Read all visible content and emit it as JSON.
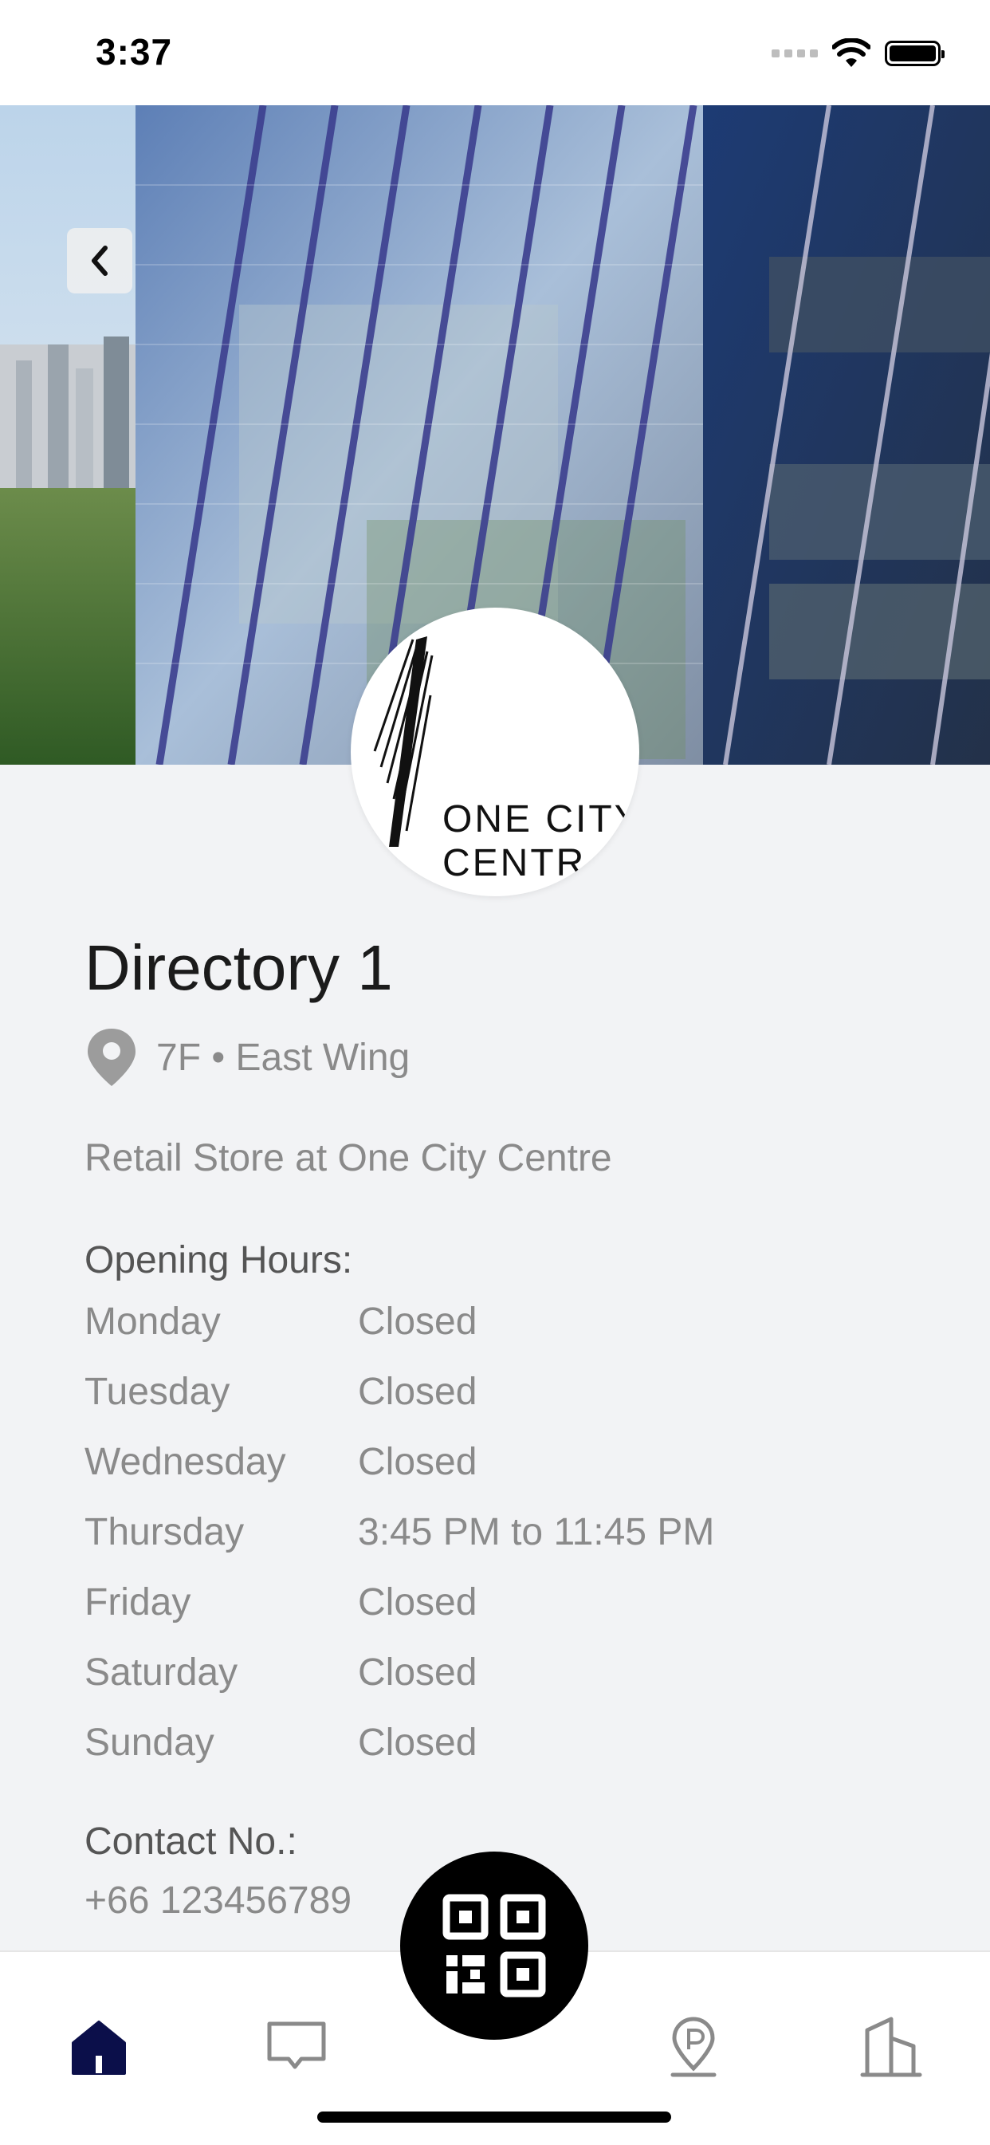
{
  "status_bar": {
    "time": "3:37"
  },
  "header": {
    "back_icon": "chevron-left-icon"
  },
  "logo": {
    "text": "ONE CITY\nCENTR"
  },
  "directory": {
    "title": "Directory 1",
    "location_icon": "map-pin-icon",
    "location": "7F • East Wing",
    "description": "Retail Store at One City Centre"
  },
  "opening_hours": {
    "label": "Opening Hours:",
    "days": [
      {
        "day": "Monday",
        "hours": "Closed"
      },
      {
        "day": "Tuesday",
        "hours": "Closed"
      },
      {
        "day": "Wednesday",
        "hours": "Closed"
      },
      {
        "day": "Thursday",
        "hours": "3:45 PM to 11:45 PM"
      },
      {
        "day": "Friday",
        "hours": "Closed"
      },
      {
        "day": "Saturday",
        "hours": "Closed"
      },
      {
        "day": "Sunday",
        "hours": "Closed"
      }
    ]
  },
  "contact": {
    "label": "Contact No.:",
    "value": "+66 123456789"
  },
  "tab_bar": {
    "items": [
      {
        "icon": "home-icon",
        "active": true
      },
      {
        "icon": "chat-icon",
        "active": false
      },
      {
        "icon": "qr-code-icon",
        "active": false
      },
      {
        "icon": "parking-location-icon",
        "active": false
      },
      {
        "icon": "building-icon",
        "active": false
      }
    ],
    "active_color": "#0b0f4a",
    "inactive_color": "#8a8a8a"
  }
}
